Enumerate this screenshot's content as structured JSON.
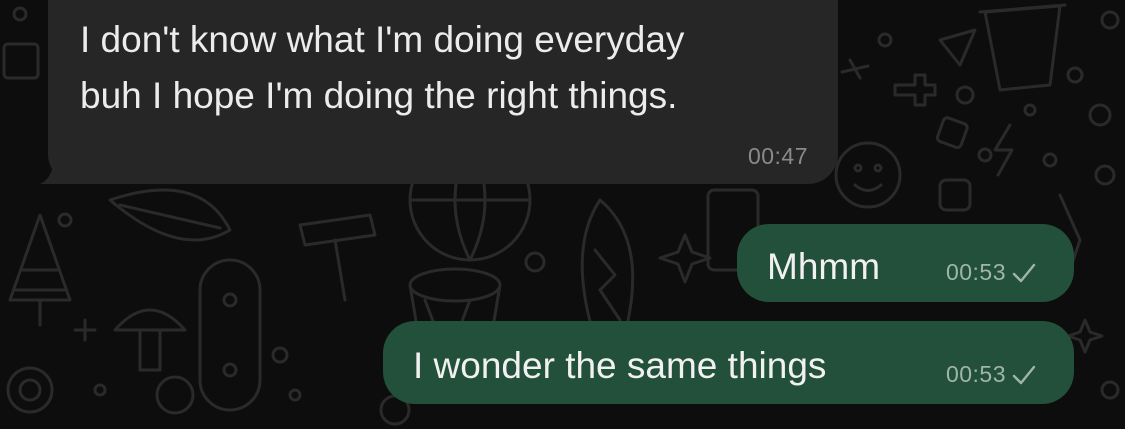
{
  "chat": {
    "messages": [
      {
        "direction": "incoming",
        "text": "I don't know what I'm doing everyday\nbuh I hope I'm doing the right things.",
        "time": "00:47"
      },
      {
        "direction": "outgoing",
        "text": "Mhmm",
        "time": "00:53",
        "status_icon": "single-check-icon"
      },
      {
        "direction": "outgoing",
        "text": "I wonder the same things",
        "time": "00:53",
        "status_icon": "single-check-icon"
      }
    ]
  },
  "theme": {
    "background": "#0d0d0d",
    "incoming_bubble": "#262626",
    "outgoing_bubble": "#22503a",
    "doodle_stroke": "#2a2a2a"
  }
}
